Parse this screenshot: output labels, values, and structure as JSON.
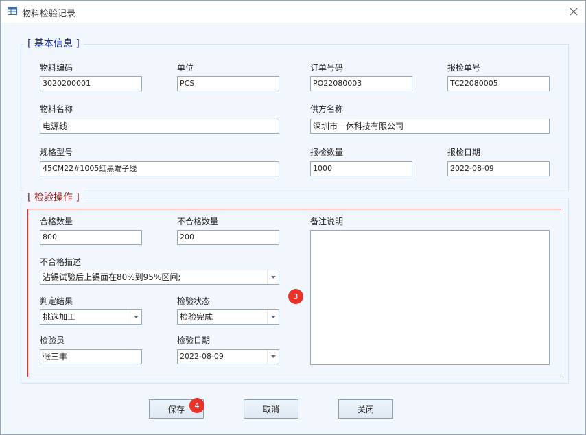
{
  "window": {
    "title": "物料检验记录"
  },
  "basic_info": {
    "legend": "[ 基本信息 ]",
    "material_code": {
      "label": "物料编码",
      "value": "3020200001"
    },
    "unit": {
      "label": "单位",
      "value": "PCS"
    },
    "order_no": {
      "label": "订单号码",
      "value": "PO22080003"
    },
    "inspection_request_no": {
      "label": "报检单号",
      "value": "TC22080005"
    },
    "material_name": {
      "label": "物料名称",
      "value": "电源线"
    },
    "supplier_name": {
      "label": "供方名称",
      "value": "深圳市一休科技有限公司"
    },
    "spec_model": {
      "label": "规格型号",
      "value": "45CM22#1005红黑端子线"
    },
    "request_qty": {
      "label": "报检数量",
      "value": "1000"
    },
    "request_date": {
      "label": "报检日期",
      "value": "2022-08-09"
    }
  },
  "inspection": {
    "legend": "[ 检验操作 ]",
    "pass_qty": {
      "label": "合格数量",
      "value": "800"
    },
    "fail_qty": {
      "label": "不合格数量",
      "value": "200"
    },
    "remarks": {
      "label": "备注说明",
      "value": ""
    },
    "fail_desc": {
      "label": "不合格描述",
      "value": "沾锡试验后上锡面在80%到95%区间;"
    },
    "judgement": {
      "label": "判定结果",
      "value": "挑选加工"
    },
    "status": {
      "label": "检验状态",
      "value": "检验完成"
    },
    "inspector": {
      "label": "检验员",
      "value": "张三丰"
    },
    "inspect_date": {
      "label": "检验日期",
      "value": "2022-08-09"
    }
  },
  "markers": {
    "inspection_area": "3",
    "save": "4"
  },
  "buttons": {
    "save": "保存",
    "cancel": "取消",
    "close": "关闭"
  },
  "colors": {
    "basic_legend": "#1a2ea8",
    "inspection_legend": "#8b1a1a",
    "highlight_border": "#d9373a",
    "marker": "#e8322a"
  }
}
